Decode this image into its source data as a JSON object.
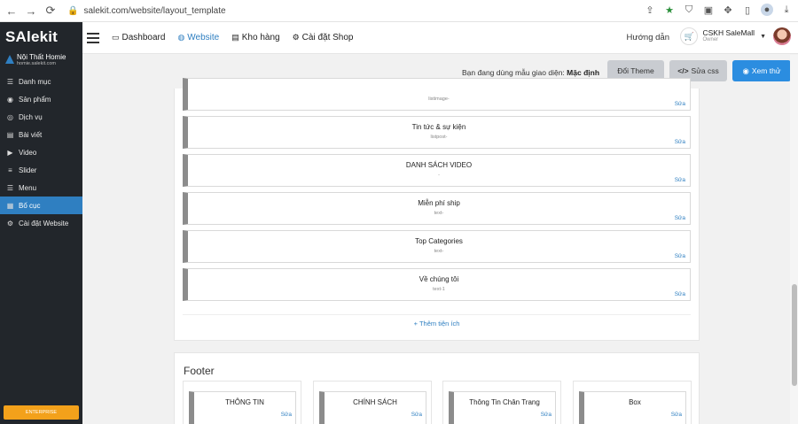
{
  "browser": {
    "url": "salekit.com/website/layout_template"
  },
  "sidebar": {
    "logo": "SAlekit",
    "shop_name": "Nội Thất Homie",
    "shop_domain": "homie.salekit.com",
    "items": [
      {
        "label": "Danh mục",
        "icon": "list-icon"
      },
      {
        "label": "Sản phẩm",
        "icon": "product-icon"
      },
      {
        "label": "Dịch vụ",
        "icon": "service-icon"
      },
      {
        "label": "Bài viết",
        "icon": "article-icon"
      },
      {
        "label": "Video",
        "icon": "video-icon"
      },
      {
        "label": "Slider",
        "icon": "slider-icon"
      },
      {
        "label": "Menu",
        "icon": "menu-icon"
      },
      {
        "label": "Bố cục",
        "icon": "layout-icon",
        "active": true
      },
      {
        "label": "Cài đặt Website",
        "icon": "settings-icon"
      }
    ],
    "plan_badge": "ENTERPRISE"
  },
  "topnav": {
    "items": [
      {
        "label": "Dashboard",
        "icon": "monitor-icon"
      },
      {
        "label": "Website",
        "icon": "globe-icon",
        "active": true
      },
      {
        "label": "Kho hàng",
        "icon": "database-icon"
      },
      {
        "label": "Cài đặt Shop",
        "icon": "gear-icon"
      }
    ],
    "guide_label": "Hướng dẫn",
    "user_name": "CSKH SaleMall",
    "user_role": "Owner"
  },
  "actions": {
    "theme_prefix": "Bạn đang dùng mẫu giao diện:",
    "theme_name": "Mặc định",
    "change_theme": "Đổi Theme",
    "edit_css": "Sửa css",
    "preview": "Xem thử"
  },
  "layout": {
    "blocks": [
      {
        "title": "",
        "subtitle": "listimage-",
        "edit": "Sửa"
      },
      {
        "title": "Tin tức & sự kiện",
        "subtitle": "listpost-",
        "edit": "Sửa"
      },
      {
        "title": "DANH SÁCH VIDEO",
        "subtitle": "-",
        "edit": "Sửa"
      },
      {
        "title": "Miễn phí ship",
        "subtitle": "text-",
        "edit": "Sửa"
      },
      {
        "title": "Top Categories",
        "subtitle": "text-",
        "edit": "Sửa"
      },
      {
        "title": "Về chúng tôi",
        "subtitle": "text-1",
        "edit": "Sửa"
      }
    ],
    "add_widget": "+ Thêm tiện ích"
  },
  "footer": {
    "title": "Footer",
    "columns": [
      {
        "title": "THÔNG TIN",
        "edit": "Sửa"
      },
      {
        "title": "CHÍNH SÁCH",
        "edit": "Sửa"
      },
      {
        "title": "Thông Tin Chân Trang",
        "edit": "Sửa"
      },
      {
        "title": "Box",
        "edit": "Sửa"
      }
    ]
  }
}
